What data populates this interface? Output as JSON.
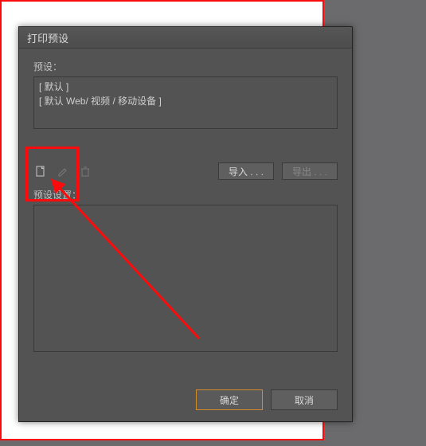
{
  "dialog": {
    "title": "打印预设",
    "preset_label": "预设：",
    "preset_items": [
      "[ 默认 ]",
      "[ 默认 Web/ 视频 / 移动设备 ]"
    ],
    "import_label": "导入 . . .",
    "export_label": "导出 . . .",
    "settings_label": "预设设置：",
    "ok_label": "确定",
    "cancel_label": "取消"
  },
  "icons": {
    "new": "new-page-icon",
    "edit": "pencil-icon",
    "delete": "trash-icon"
  },
  "annotation": {
    "color": "#fb0b0b"
  }
}
